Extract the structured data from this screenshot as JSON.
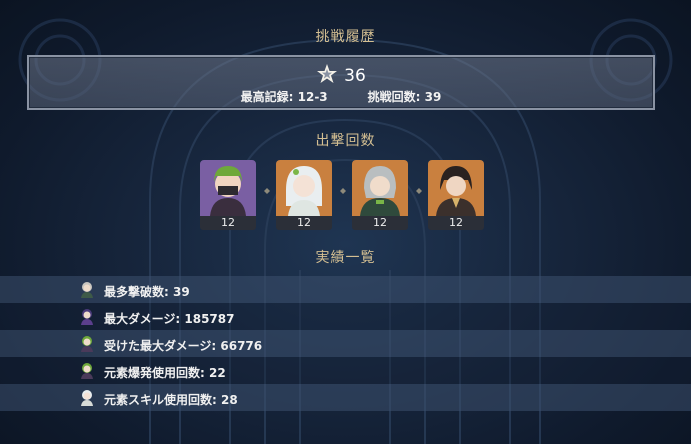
{
  "history_title": "挑戦履歴",
  "record": {
    "stars": "36",
    "best_label": "最高記録: 12-3",
    "attempts_label": "挑戦回数: 39"
  },
  "sortie_title": "出撃回数",
  "characters": [
    {
      "count": "12",
      "icon": "character-1-icon"
    },
    {
      "count": "12",
      "icon": "character-2-icon"
    },
    {
      "count": "12",
      "icon": "character-3-icon"
    },
    {
      "count": "12",
      "icon": "character-4-icon"
    }
  ],
  "achievements_title": "実績一覧",
  "achievements": [
    {
      "text": "最多撃破数: 39"
    },
    {
      "text": "最大ダメージ: 185787"
    },
    {
      "text": "受けた最大ダメージ: 66776"
    },
    {
      "text": "元素爆発使用回数: 22"
    },
    {
      "text": "元素スキル使用回数: 28"
    }
  ],
  "colors": {
    "title": "#d4bf92",
    "panel_border": "#8a93a3"
  }
}
